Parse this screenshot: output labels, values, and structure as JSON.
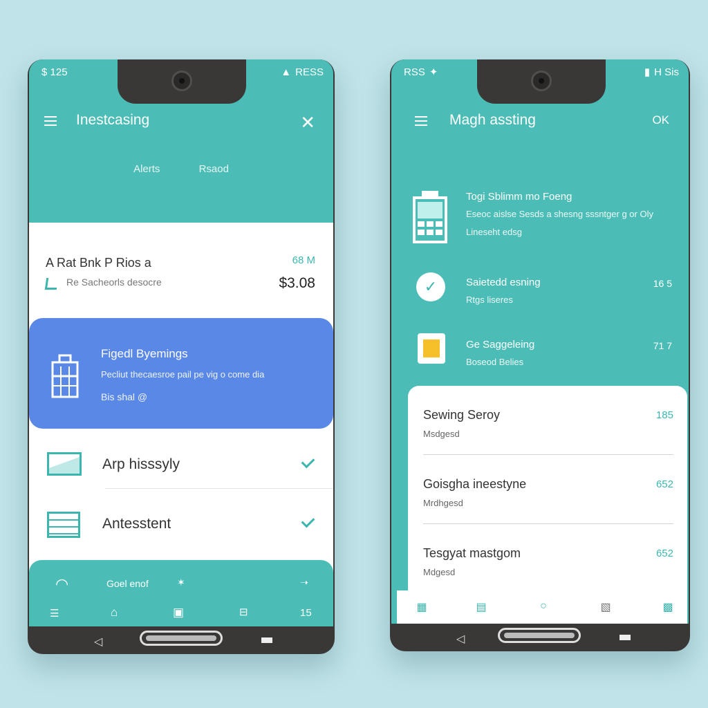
{
  "left_phone": {
    "status_left": "$ 125",
    "status_right": "RESS",
    "title": "Inestcasing",
    "tabs": [
      "Alerts",
      "Rsaod"
    ],
    "summary": {
      "title": "A Rat Bnk P Rios a",
      "size": "68 M",
      "subtitle": "Re Sacheorls desocre",
      "price": "$3.08"
    },
    "card": {
      "title": "Figedl Byemings",
      "description": "Pecliut thecaesroe pail pe vig o come dia",
      "meta": "Bis shal @"
    },
    "rows": [
      {
        "label": "Arp hisssyly"
      },
      {
        "label": "Antesstent"
      }
    ],
    "bottom_bar": {
      "top_label": "Goel enof",
      "bottom_number": "15"
    }
  },
  "right_phone": {
    "status_left": "RSS",
    "status_right": "H Sis",
    "title": "Magh assting",
    "ok": "OK",
    "header_item": {
      "title": "Togi Sblimm mo Foeng",
      "description": "Eseoc aislse Sesds a shesng sssntger g or Oly",
      "meta": "Lineseht edsg"
    },
    "items": [
      {
        "title": "Saietedd esning",
        "subtitle": "Rtgs liseres",
        "value": "16 5"
      },
      {
        "title": "Ge Saggeleing",
        "subtitle": "Boseod Belies",
        "value": "71 7"
      }
    ],
    "panel_rows": [
      {
        "title": "Sewing Seroy",
        "subtitle": "Msdgesd",
        "value": "185"
      },
      {
        "title": "Goisgha ineestyne",
        "subtitle": "Mrdhgesd",
        "value": "652"
      },
      {
        "title": "Tesgyat mastgom",
        "subtitle": "Mdgesd",
        "value": "652"
      }
    ]
  }
}
